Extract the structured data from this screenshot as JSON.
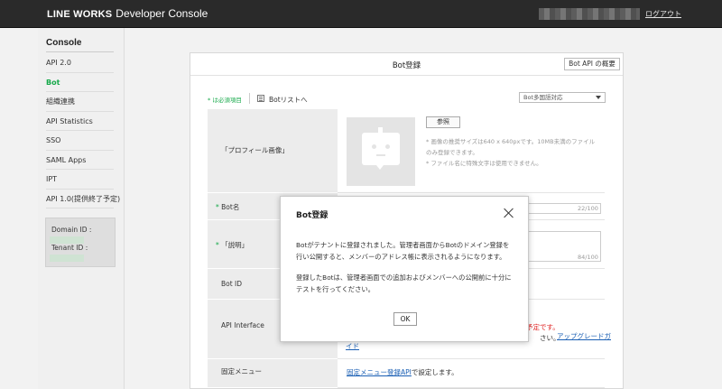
{
  "header": {
    "brand_logo": "LINE WORKS",
    "brand_title": "Developer Console",
    "logout": "ログアウト"
  },
  "sidebar": {
    "title": "Console",
    "items": [
      {
        "label": "API 2.0",
        "active": false
      },
      {
        "label": "Bot",
        "active": true
      },
      {
        "label": "組織連携",
        "active": false
      },
      {
        "label": "API Statistics",
        "active": false
      },
      {
        "label": "SSO",
        "active": false
      },
      {
        "label": "SAML Apps",
        "active": false
      },
      {
        "label": "IPT",
        "active": false
      },
      {
        "label": "API 1.0(提供終了予定)",
        "active": false
      }
    ],
    "domain_id_label": "Domain ID :",
    "tenant_id_label": "Tenant ID :"
  },
  "panel": {
    "title": "Bot登録",
    "api_overview_button": "Bot API の概要",
    "required_note": "* は必須項目",
    "bot_list_link": "Botリストへ",
    "language_select": "Bot多国語対応",
    "profile_label": "「プロフィール画像」",
    "browse_button": "参照",
    "hint_1": "* 画像の推奨サイズは640 x 640pxです。10MB未満のファイル",
    "hint_2": "のみ登録できます。",
    "hint_3": "* ファイル名に特殊文字は使用できません。",
    "bot_name_label": "Bot名",
    "bot_name_count": "22/100",
    "description_label": "「説明」",
    "description_count": "84/100",
    "bot_id_label": "Bot ID",
    "api_interface_label": "API Interface",
    "api_warning": "する予定です。",
    "api_text": "さい。",
    "api_upgrade_link": "アップグレードガ",
    "api_upgrade_link_2": "イド",
    "fixed_menu_label": "固定メニュー",
    "fixed_menu_link": "固定メニュー登録API",
    "fixed_menu_text": "で設定します。"
  },
  "modal": {
    "title": "Bot登録",
    "line_1": "Botがテナントに登録されました。管理者画面からBotのドメイン登録を",
    "line_2": "行い公開すると、メンバーのアドレス帳に表示されるようになります。",
    "line_3": "登録したBotは、管理者画面での追加およびメンバーへの公開前に十分に",
    "line_4": "テストを行ってください。",
    "ok_button": "OK"
  }
}
